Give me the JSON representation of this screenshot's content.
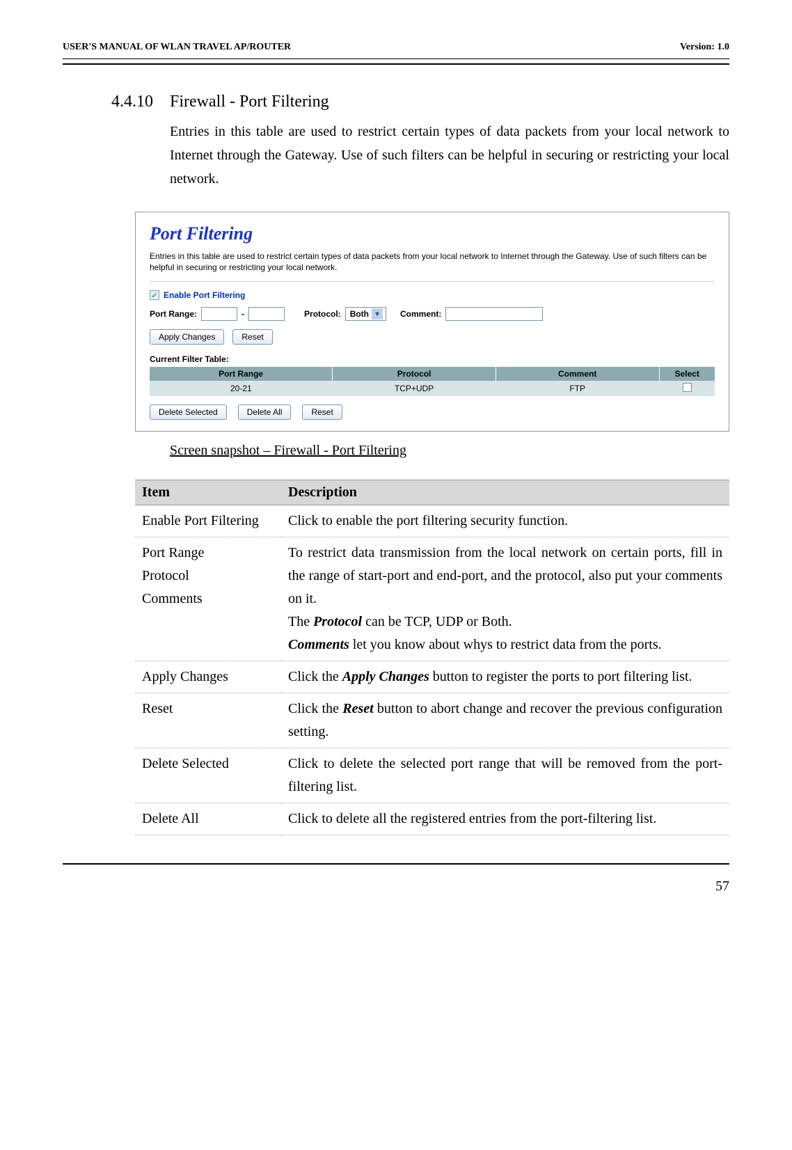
{
  "header": {
    "left": "USER'S MANUAL OF WLAN TRAVEL AP/ROUTER",
    "right": "Version: 1.0"
  },
  "section": {
    "number": "4.4.10",
    "title": "Firewall - Port Filtering",
    "intro": "Entries in this table are used to restrict certain types of data packets from your local network to Internet through the Gateway. Use of such filters can be helpful in securing or restricting your local network."
  },
  "panel": {
    "title": "Port Filtering",
    "desc": "Entries in this table are used to restrict certain types of data packets from your local network to Internet through the Gateway. Use of such filters can be helpful in securing or restricting your local network.",
    "enable_label": "Enable Port Filtering",
    "portrange_label": "Port Range:",
    "protocol_label": "Protocol:",
    "protocol_value": "Both",
    "comment_label": "Comment:",
    "apply_btn": "Apply Changes",
    "reset_btn": "Reset",
    "table_caption": "Current Filter Table:",
    "columns": {
      "c1": "Port Range",
      "c2": "Protocol",
      "c3": "Comment",
      "c4": "Select"
    },
    "row": {
      "c1": "20-21",
      "c2": "TCP+UDP",
      "c3": "FTP"
    },
    "delete_selected_btn": "Delete Selected",
    "delete_all_btn": "Delete All",
    "reset2_btn": "Reset"
  },
  "caption": "Screen snapshot – Firewall - Port Filtering",
  "descTable": {
    "h1": "Item",
    "h2": "Description",
    "rows": [
      {
        "item": "Enable Port Filtering",
        "desc_plain": "Click to enable the port filtering security function."
      },
      {
        "item_lines": [
          "Port Range",
          "Protocol",
          "Comments"
        ],
        "d1": "To restrict data transmission from the local network on certain ports, fill in the range of start-port and end-port, and the protocol, also put your comments on it.",
        "d2a": "The ",
        "d2b": "Protocol",
        "d2c": " can be TCP, UDP or Both.",
        "d3a": "Comments",
        "d3b": " let you know about whys to restrict data from the ports."
      },
      {
        "item": "Apply Changes",
        "pa": "Click the ",
        "pb": "Apply Changes",
        "pc": " button to register the ports to port filtering list."
      },
      {
        "item": "Reset",
        "pa": "Click the ",
        "pb": "Reset",
        "pc": " button to abort change and recover the previous configuration setting."
      },
      {
        "item": "Delete Selected",
        "desc_plain": "Click to delete the selected port range that will be removed from the port-filtering list."
      },
      {
        "item": "Delete All",
        "desc_plain": "Click to delete all the registered entries from the port-filtering list."
      }
    ]
  },
  "page_number": "57"
}
